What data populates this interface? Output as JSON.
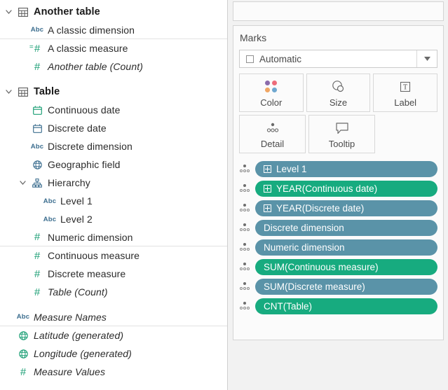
{
  "data_pane": {
    "groups": [
      {
        "name": "Another table",
        "icon": "table-icon",
        "expanded": true,
        "fields": [
          {
            "label": "A classic dimension",
            "icon": "abc-icon",
            "indent": 1,
            "italic": false,
            "separator_after": true
          },
          {
            "label": "A classic measure",
            "icon": "continuous-measure-icon",
            "indent": 1,
            "italic": false,
            "separator_after": false
          },
          {
            "label": "Another table (Count)",
            "icon": "measure-icon",
            "indent": 1,
            "italic": true,
            "separator_after": false
          }
        ]
      },
      {
        "name": "Table",
        "icon": "table-icon",
        "expanded": true,
        "fields": [
          {
            "label": "Continuous date",
            "icon": "calendar-green-icon",
            "indent": 1,
            "italic": false,
            "separator_after": false
          },
          {
            "label": "Discrete date",
            "icon": "calendar-blue-icon",
            "indent": 1,
            "italic": false,
            "separator_after": false
          },
          {
            "label": "Discrete dimension",
            "icon": "abc-icon",
            "indent": 1,
            "italic": false,
            "separator_after": false
          },
          {
            "label": "Geographic field",
            "icon": "globe-blue-icon",
            "indent": 1,
            "italic": false,
            "separator_after": false
          },
          {
            "label": "Hierarchy",
            "icon": "hierarchy-icon",
            "indent": 1,
            "italic": false,
            "expanded": true,
            "separator_after": false
          },
          {
            "label": "Level 1",
            "icon": "abc-icon",
            "indent": 2,
            "italic": false,
            "separator_after": false
          },
          {
            "label": "Level 2",
            "icon": "abc-icon",
            "indent": 2,
            "italic": false,
            "separator_after": false
          },
          {
            "label": "Numeric dimension",
            "icon": "measure-icon",
            "indent": 1,
            "italic": false,
            "separator_after": true
          },
          {
            "label": "Continuous measure",
            "icon": "measure-icon",
            "indent": 1,
            "italic": false,
            "separator_after": false
          },
          {
            "label": "Discrete measure",
            "icon": "measure-icon",
            "indent": 1,
            "italic": false,
            "separator_after": false
          },
          {
            "label": "Table (Count)",
            "icon": "measure-icon",
            "indent": 1,
            "italic": true,
            "separator_after": false
          }
        ]
      }
    ],
    "generated_fields": [
      {
        "label": "Measure Names",
        "icon": "abc-icon",
        "indent": 0,
        "italic": true,
        "separator_after": true
      },
      {
        "label": "Latitude (generated)",
        "icon": "globe-green-icon",
        "indent": 0,
        "italic": true,
        "separator_after": false
      },
      {
        "label": "Longitude (generated)",
        "icon": "globe-green-icon",
        "indent": 0,
        "italic": true,
        "separator_after": false
      },
      {
        "label": "Measure Values",
        "icon": "measure-icon",
        "indent": 0,
        "italic": true,
        "separator_after": false
      }
    ]
  },
  "marks": {
    "title": "Marks",
    "mark_type": {
      "value": "Automatic",
      "checkbox_icon": "square-icon",
      "dropdown_icon": "chevron-down-icon"
    },
    "buttons": [
      {
        "label": "Color",
        "icon": "color-dots-icon"
      },
      {
        "label": "Size",
        "icon": "size-circles-icon"
      },
      {
        "label": "Label",
        "icon": "label-t-icon"
      },
      {
        "label": "Detail",
        "icon": "detail-dots-icon"
      },
      {
        "label": "Tooltip",
        "icon": "tooltip-bubble-icon"
      }
    ],
    "pills": [
      {
        "label": "Level 1",
        "color": "blue",
        "has_plus": true,
        "shelf_icon": "detail-dots-icon"
      },
      {
        "label": "YEAR(Continuous date)",
        "color": "green",
        "has_plus": true,
        "shelf_icon": "detail-dots-icon"
      },
      {
        "label": "YEAR(Discrete date)",
        "color": "blue",
        "has_plus": true,
        "shelf_icon": "detail-dots-icon"
      },
      {
        "label": "Discrete dimension",
        "color": "blue",
        "has_plus": false,
        "shelf_icon": "detail-dots-icon"
      },
      {
        "label": "Numeric dimension",
        "color": "blue",
        "has_plus": false,
        "shelf_icon": "detail-dots-icon"
      },
      {
        "label": "SUM(Continuous measure)",
        "color": "green",
        "has_plus": false,
        "shelf_icon": "detail-dots-icon"
      },
      {
        "label": "SUM(Discrete measure)",
        "color": "blue",
        "has_plus": false,
        "shelf_icon": "detail-dots-icon"
      },
      {
        "label": "CNT(Table)",
        "color": "green",
        "has_plus": false,
        "shelf_icon": "detail-dots-icon"
      }
    ]
  },
  "colors": {
    "pill_blue": "#5a93a8",
    "pill_green": "#17ab7f",
    "measure_green": "#1a9e74",
    "dimension_blue": "#3c6e8f",
    "panel_bg": "#f2f2f2",
    "card_bg": "#fbfbfb"
  }
}
